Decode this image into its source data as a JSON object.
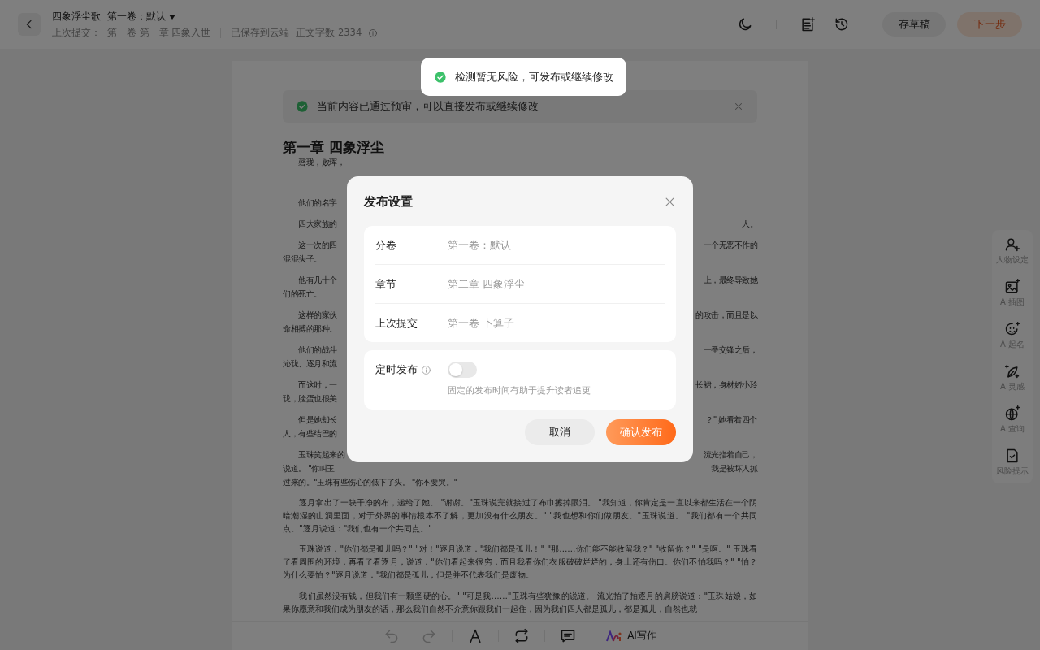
{
  "header": {
    "title": "四象浮尘歌",
    "volume": "第一卷：默认",
    "last_submit_label": "上次提交：",
    "last_submit": "第一卷 第一章 四象入世",
    "save_status": "已保存到云端",
    "word_count": "正文字数 2334"
  },
  "header_buttons": [
    {
      "label": "存草稿",
      "kind": "secondary"
    },
    {
      "label": "下一步",
      "kind": "primary"
    }
  ],
  "notice": {
    "text": "当前内容已通过预审，可以直接发布或继续修改"
  },
  "chapter_title": "第一章 四象浮尘",
  "paragraphs": [
    {
      "kind": "split",
      "lines": [
        {
          "left": "磬珑，败珲，"
        }
      ]
    },
    {
      "kind": "split",
      "lines": [
        {
          "left": "他们的名字"
        }
      ]
    },
    {
      "kind": "split",
      "lines": [
        {
          "left": "四大家族的",
          "right": "人。"
        }
      ]
    },
    {
      "kind": "split",
      "lines": [
        {
          "left": "这一次的四",
          "right": "一个无恶不作的"
        },
        {
          "left": "混混头子。"
        }
      ]
    },
    {
      "kind": "split",
      "lines": [
        {
          "left": "他有几十个",
          "right": "上，最终导致她"
        },
        {
          "left": "们的死亡。"
        }
      ]
    },
    {
      "kind": "split",
      "lines": [
        {
          "left": "这样的家伙",
          "right": "的攻击，而且是以"
        },
        {
          "left": "命相搏的那种。"
        }
      ]
    },
    {
      "kind": "split",
      "lines": [
        {
          "left": "他们的战斗",
          "right": "一番交锋之后，"
        },
        {
          "left": "沁珑、逐月和流"
        }
      ]
    },
    {
      "kind": "split",
      "lines": [
        {
          "left": "而这时，一",
          "right": "长裙，身材娇小玲"
        },
        {
          "left": "珑，脸蛋也很美"
        }
      ]
    },
    {
      "kind": "split",
      "lines": [
        {
          "left": "但是她却长",
          "right": "？\" 她看着四个"
        },
        {
          "left": "人，有些结巴的"
        }
      ]
    },
    {
      "kind": "split",
      "lines": [
        {
          "left": "玉珠笑起来的",
          "right": "流光指着自己，"
        },
        {
          "left": "说道。 \"你叫玉",
          "right": "我是被坏人抓"
        },
        {
          "left": "过来的。\"玉珠有些伤心的低下了头。 \"你不要哭。\""
        }
      ]
    },
    {
      "kind": "full",
      "text": "逐月拿出了一块干净的布，递给了她。 \"谢谢。\"玉珠说完就接过了布巾擦掉眼泪。 \"我知道，你肯定是一直以来都生活在一个阴暗潮湿的山洞里面，对于外界的事情根本不了解，更加没有什么朋友。\" \"我也想和你们做朋友。\"玉珠说道。 \"我们都有一个共同点。\"逐月说道：\"我们也有一个共同点。\""
    },
    {
      "kind": "full",
      "text": "玉珠说道：\"你们都是孤儿吗？\" \"对！\"逐月说道：\"我们都是孤儿！\" \"那……你们能不能收留我？\" \"收留你？\" \"是啊。\" 玉珠看了看周围的环境，再看了看逐月，说道：\"你们看起来很穷，而且我看你们衣服破破烂烂的，身上还有伤口。你们不怕我吗？\" \"怕？为什么要怕？\"逐月说道：\"我们都是孤儿，但是并不代表我们是废物。"
    },
    {
      "kind": "full",
      "text": "我们虽然没有钱，但我们有一颗坚硬的心。\" \"可是我……\"玉珠有些犹豫的说道。 流光拍了拍逐月的肩膀说道：\"玉珠姑娘，如果你愿意和我们成为朋友的话，那么我们自然不介意你跟我们一起住，因为我们四人都是孤儿，都是孤儿，自然也就"
    }
  ],
  "editor_tools": [
    {
      "kind": "undo",
      "disabled": true
    },
    {
      "kind": "redo",
      "disabled": true
    },
    {
      "kind": "font",
      "disabled": false
    },
    {
      "kind": "convert",
      "disabled": false
    },
    {
      "kind": "comment",
      "disabled": false
    },
    {
      "kind": "ai",
      "label": "AI写作",
      "disabled": false
    }
  ],
  "side_tools": [
    {
      "kind": "person",
      "label": "人物设定"
    },
    {
      "kind": "image",
      "label": "AI插图"
    },
    {
      "kind": "name",
      "label": "AI起名"
    },
    {
      "kind": "idea",
      "label": "AI灵感"
    },
    {
      "kind": "search",
      "label": "AI查询"
    },
    {
      "kind": "risk",
      "label": "风险提示"
    }
  ],
  "toast": {
    "text": "检测暂无风险，可发布或继续修改"
  },
  "dialog": {
    "title": "发布设置",
    "fields": [
      {
        "label": "分卷",
        "value": "第一卷：默认"
      },
      {
        "label": "章节",
        "value": "第二章 四象浮尘"
      },
      {
        "label": "上次提交",
        "value": "第一卷 卜算子"
      }
    ],
    "schedule": {
      "label": "定时发布",
      "on": false,
      "hint": "固定的发布时间有助于提升读者追更"
    },
    "buttons": [
      {
        "label": "取消",
        "kind": "secondary"
      },
      {
        "label": "确认发布",
        "kind": "primary"
      }
    ]
  }
}
